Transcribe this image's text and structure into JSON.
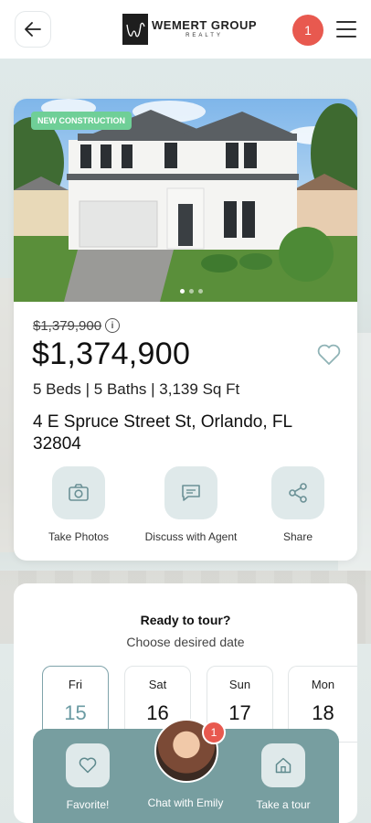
{
  "header": {
    "logo_title": "WEMERT GROUP",
    "logo_sub": "REALTY",
    "notification_count": "1"
  },
  "listing": {
    "tag": "NEW CONSTRUCTION",
    "original_price": "$1,379,900",
    "price": "$1,374,900",
    "specs": "5 Beds | 5 Baths | 3,139 Sq Ft",
    "address": "4 E Spruce Street St, Orlando, FL 32804",
    "photo_index": 1,
    "photo_count": 3
  },
  "actions": [
    {
      "label": "Take Photos",
      "icon": "camera-icon"
    },
    {
      "label": "Discuss with Agent",
      "icon": "chat-bubble-icon"
    },
    {
      "label": "Share",
      "icon": "share-icon"
    }
  ],
  "tour": {
    "title": "Ready to tour?",
    "subtitle": "Choose desired date",
    "days": [
      {
        "name": "Fri",
        "num": "15",
        "selected": true
      },
      {
        "name": "Sat",
        "num": "16",
        "selected": false
      },
      {
        "name": "Sun",
        "num": "17",
        "selected": false
      },
      {
        "name": "Mon",
        "num": "18",
        "selected": false
      }
    ]
  },
  "bottom_bar": {
    "favorite_label": "Favorite!",
    "chat_label": "Chat with Emily",
    "tour_label": "Take a tour",
    "chat_badge": "1"
  },
  "colors": {
    "accent": "#779ea0",
    "badge": "#e8594f",
    "tag": "#6fcf97"
  }
}
